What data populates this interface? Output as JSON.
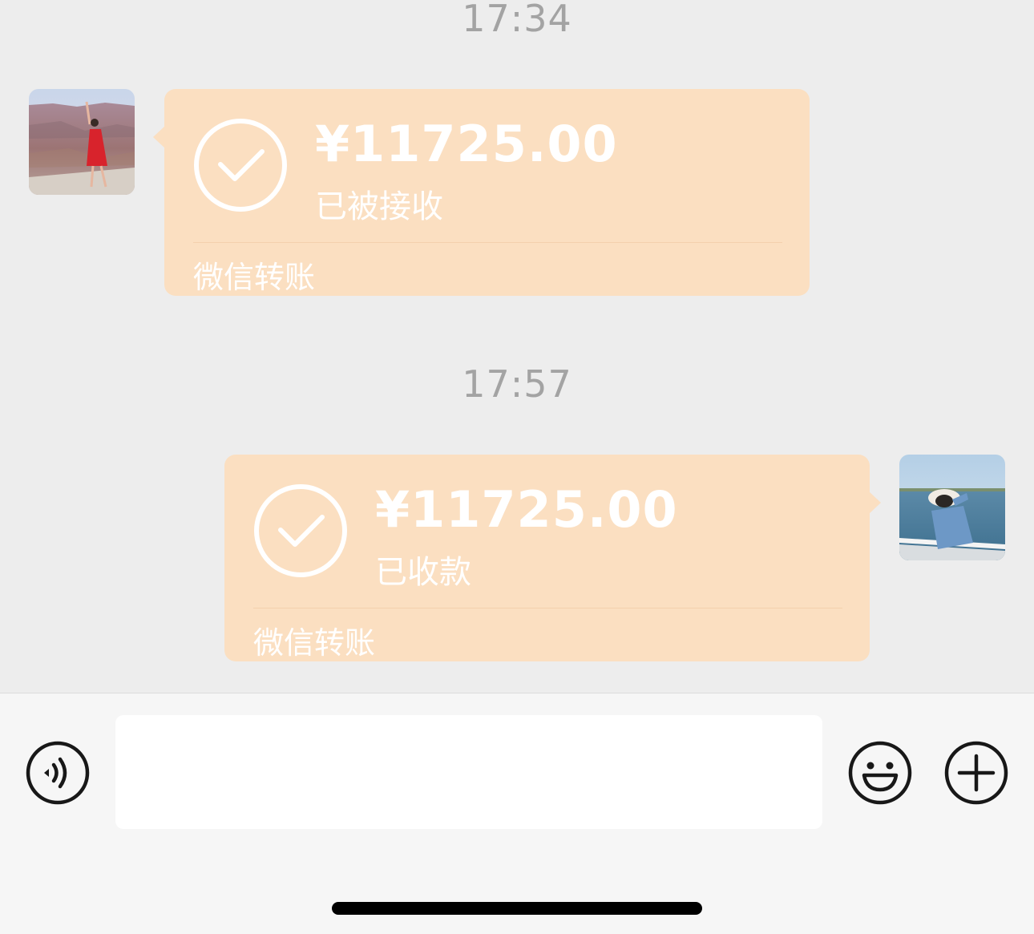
{
  "messages": [
    {
      "timestamp": "17:34",
      "side": "left",
      "avatar_icon": "avatar-canyon-photo",
      "amount": "¥11725.00",
      "status": "已被接收",
      "footer": "微信转账"
    },
    {
      "timestamp": "17:57",
      "side": "right",
      "avatar_icon": "avatar-sea-photo",
      "amount": "¥11725.00",
      "status": "已收款",
      "footer": "微信转账"
    }
  ],
  "input_bar": {
    "input_value": "",
    "voice_icon": "voice-icon",
    "emoji_icon": "emoji-icon",
    "plus_icon": "plus-icon"
  },
  "colors": {
    "chat_background": "#ededed",
    "bubble": "#fbdfc1",
    "bubble_text": "#ffffff",
    "timestamp": "#a3a3a3",
    "input_bar": "#f6f6f6"
  }
}
